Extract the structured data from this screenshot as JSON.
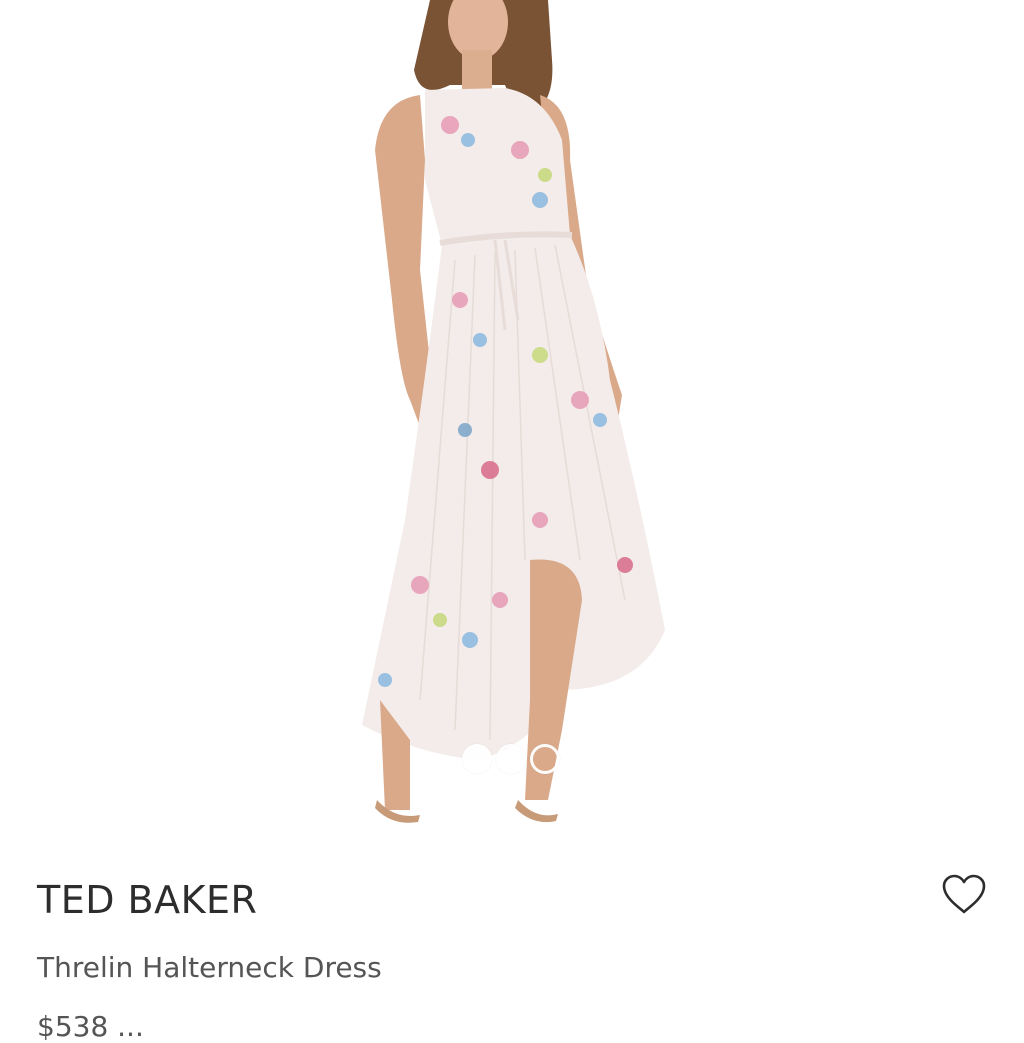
{
  "product": {
    "brand": "TED BAKER",
    "name": "Threlin Halterneck Dress",
    "price_text": "$538 ..."
  },
  "gallery": {
    "image_label": "model-wearing-floral-halterneck-dress",
    "slide_count": 3,
    "active_slide": 1
  },
  "icons": {
    "wishlist": "heart-outline-icon"
  },
  "colors": {
    "text_primary": "#2d2d2d",
    "text_secondary": "#555555",
    "dress": "#f3ecea",
    "skin": "#d9a98a"
  }
}
